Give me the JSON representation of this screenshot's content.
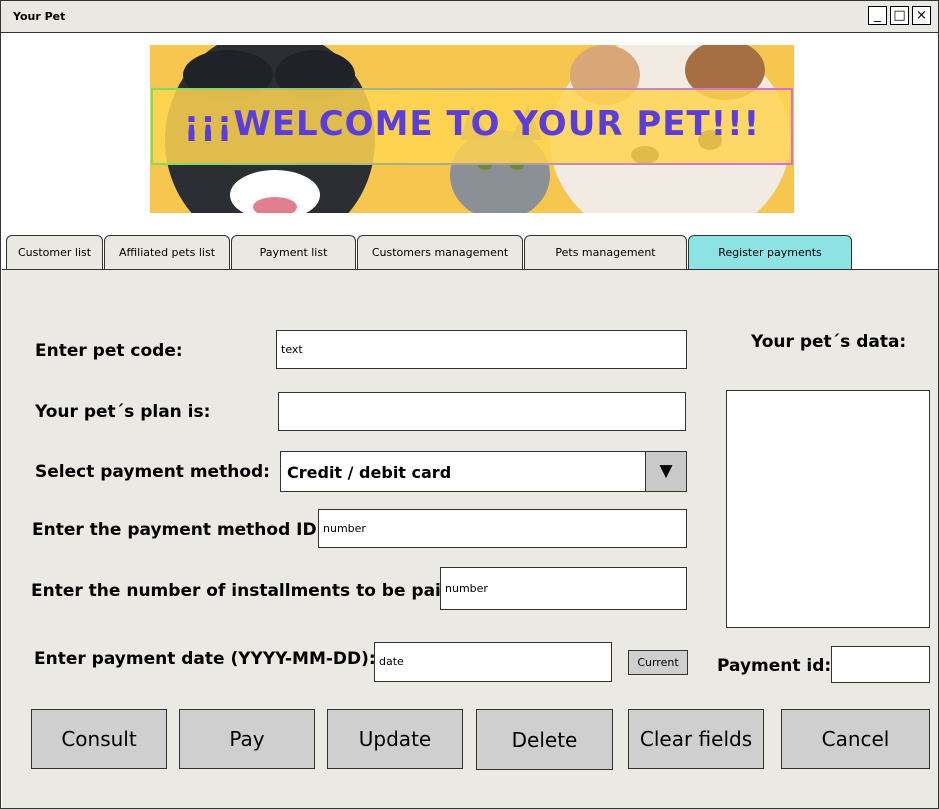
{
  "window": {
    "title": "Your Pet",
    "controls": [
      "_",
      "□",
      "×"
    ]
  },
  "banner": {
    "welcome_text": "¡¡¡WELCOME TO YOUR PET!!!"
  },
  "tabs": [
    {
      "label": "Customer list"
    },
    {
      "label": "Affiliated pets list"
    },
    {
      "label": "Payment list"
    },
    {
      "label": "Customers management"
    },
    {
      "label": "Pets management"
    },
    {
      "label": "Register payments",
      "active": true
    }
  ],
  "form": {
    "pet_code": {
      "label": "Enter pet code:",
      "value": "text"
    },
    "plan": {
      "label": "Your pet´s plan is:",
      "value": ""
    },
    "payment_method": {
      "label": "Select payment method:",
      "selected": "Credit / debit card"
    },
    "method_id": {
      "label": "Enter the payment method ID:",
      "value": "number"
    },
    "installments": {
      "label": "Enter the number of installments to be paid:",
      "value": "number"
    },
    "payment_date": {
      "label": "Enter payment date (YYYY-MM-DD):",
      "value": "date",
      "current_button": "Current"
    },
    "payment_id": {
      "label": "Payment id:",
      "value": ""
    }
  },
  "side_panel": {
    "title": "Your pet´s data:"
  },
  "buttons": {
    "consult": "Consult",
    "pay": "Pay",
    "update": "Update",
    "delete": "Delete",
    "clear": "Clear fields",
    "cancel": "Cancel"
  },
  "colors": {
    "active_tab": "#8de2e3",
    "panel_bg": "#ebe9e3",
    "banner_bg": "#f7c64e",
    "welcome_text": "#5b3ed8"
  }
}
